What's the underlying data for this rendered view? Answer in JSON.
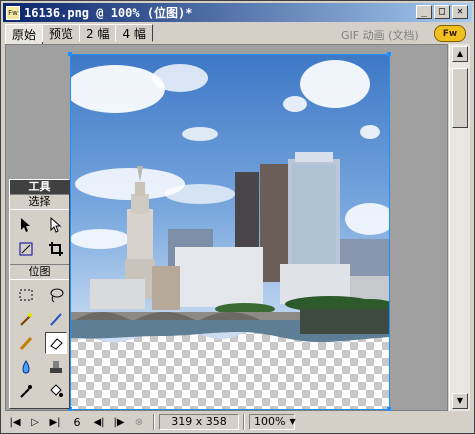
{
  "window": {
    "title": "16136.png @  100% (位图)*"
  },
  "tabs": [
    {
      "label": "原始"
    },
    {
      "label": "预览"
    },
    {
      "label": "2 幅"
    },
    {
      "label": "4 幅"
    }
  ],
  "format_label": "GIF 动画 (文档)",
  "tools": {
    "header": "工具",
    "sections": [
      {
        "label": "选择",
        "items": [
          "pointer-icon",
          "subselect-icon",
          "scale-icon",
          "crop-icon"
        ]
      },
      {
        "label": "位图",
        "items": [
          "marquee-icon",
          "lasso-icon",
          "magic-wand-icon",
          "brush-icon",
          "pencil-icon",
          "eraser-icon",
          "blur-icon",
          "rubber-stamp-icon",
          "eyedropper-icon",
          "paint-bucket-icon"
        ]
      }
    ]
  },
  "status": {
    "frame": "6",
    "dimensions": "319 x 358",
    "zoom": "100%"
  },
  "colors": {
    "sky_top": "#3d78c6",
    "sky_bottom": "#cfe0f4",
    "selection": "#1e90ff",
    "title_start": "#0a246a",
    "title_end": "#a6caf0"
  }
}
